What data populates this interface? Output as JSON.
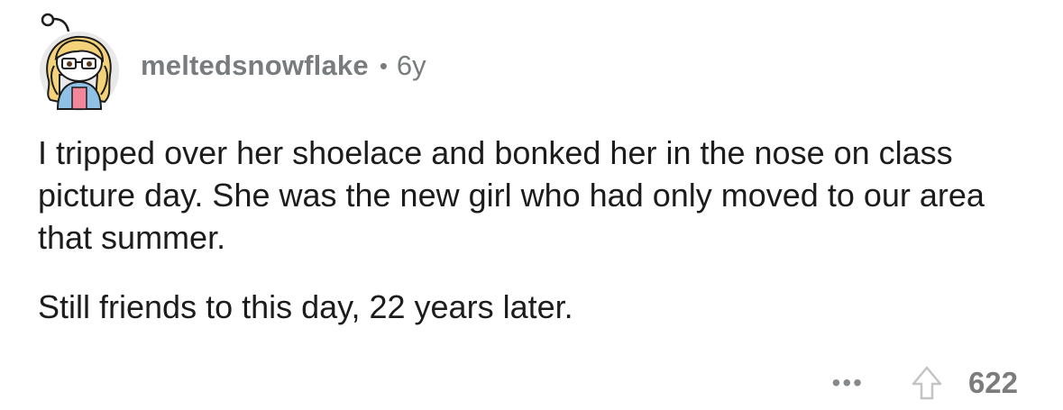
{
  "comment": {
    "username": "meltedsnowflake",
    "separator": "•",
    "age": "6y",
    "paragraphs": [
      "I tripped over her shoelace and bonked her in the nose on class picture day. She was the new girl who had only moved to our area that summer.",
      "Still friends to this day, 22 years later."
    ],
    "more_label": "•••",
    "score": "622"
  },
  "icons": {
    "avatar": "snoo-avatar-icon",
    "upvote": "upvote-arrow-icon"
  },
  "colors": {
    "text": "#1c1c1c",
    "meta": "#787c7e",
    "background": "#ffffff"
  }
}
